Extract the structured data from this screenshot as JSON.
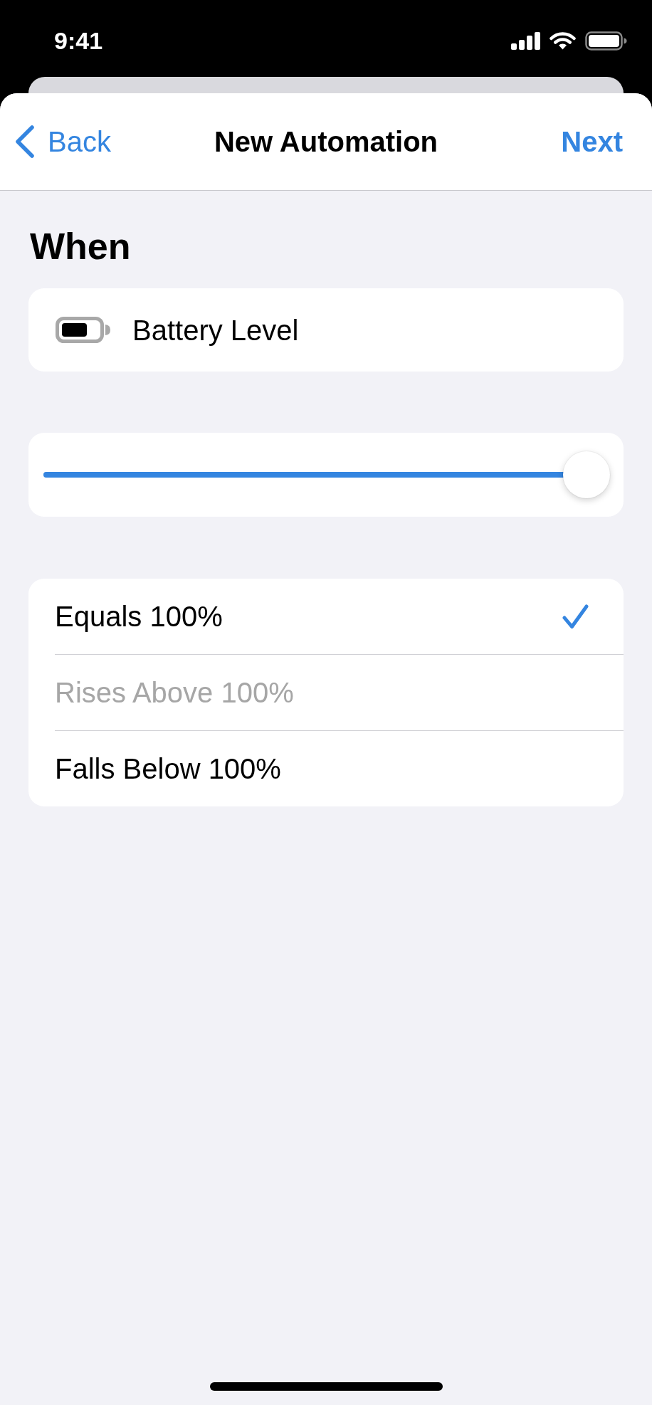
{
  "status_bar": {
    "time": "9:41"
  },
  "nav_bar": {
    "back": "Back",
    "title": "New Automation",
    "next": "Next"
  },
  "section_title": "When",
  "trigger": {
    "label": "Battery Level"
  },
  "slider": {
    "level": 1
  },
  "options": [
    {
      "label": "Equals 100%",
      "selected": true,
      "disabled": false
    },
    {
      "label": "Rises Above 100%",
      "selected": false,
      "disabled": true
    },
    {
      "label": "Falls Below 100%",
      "selected": false,
      "disabled": false
    }
  ]
}
